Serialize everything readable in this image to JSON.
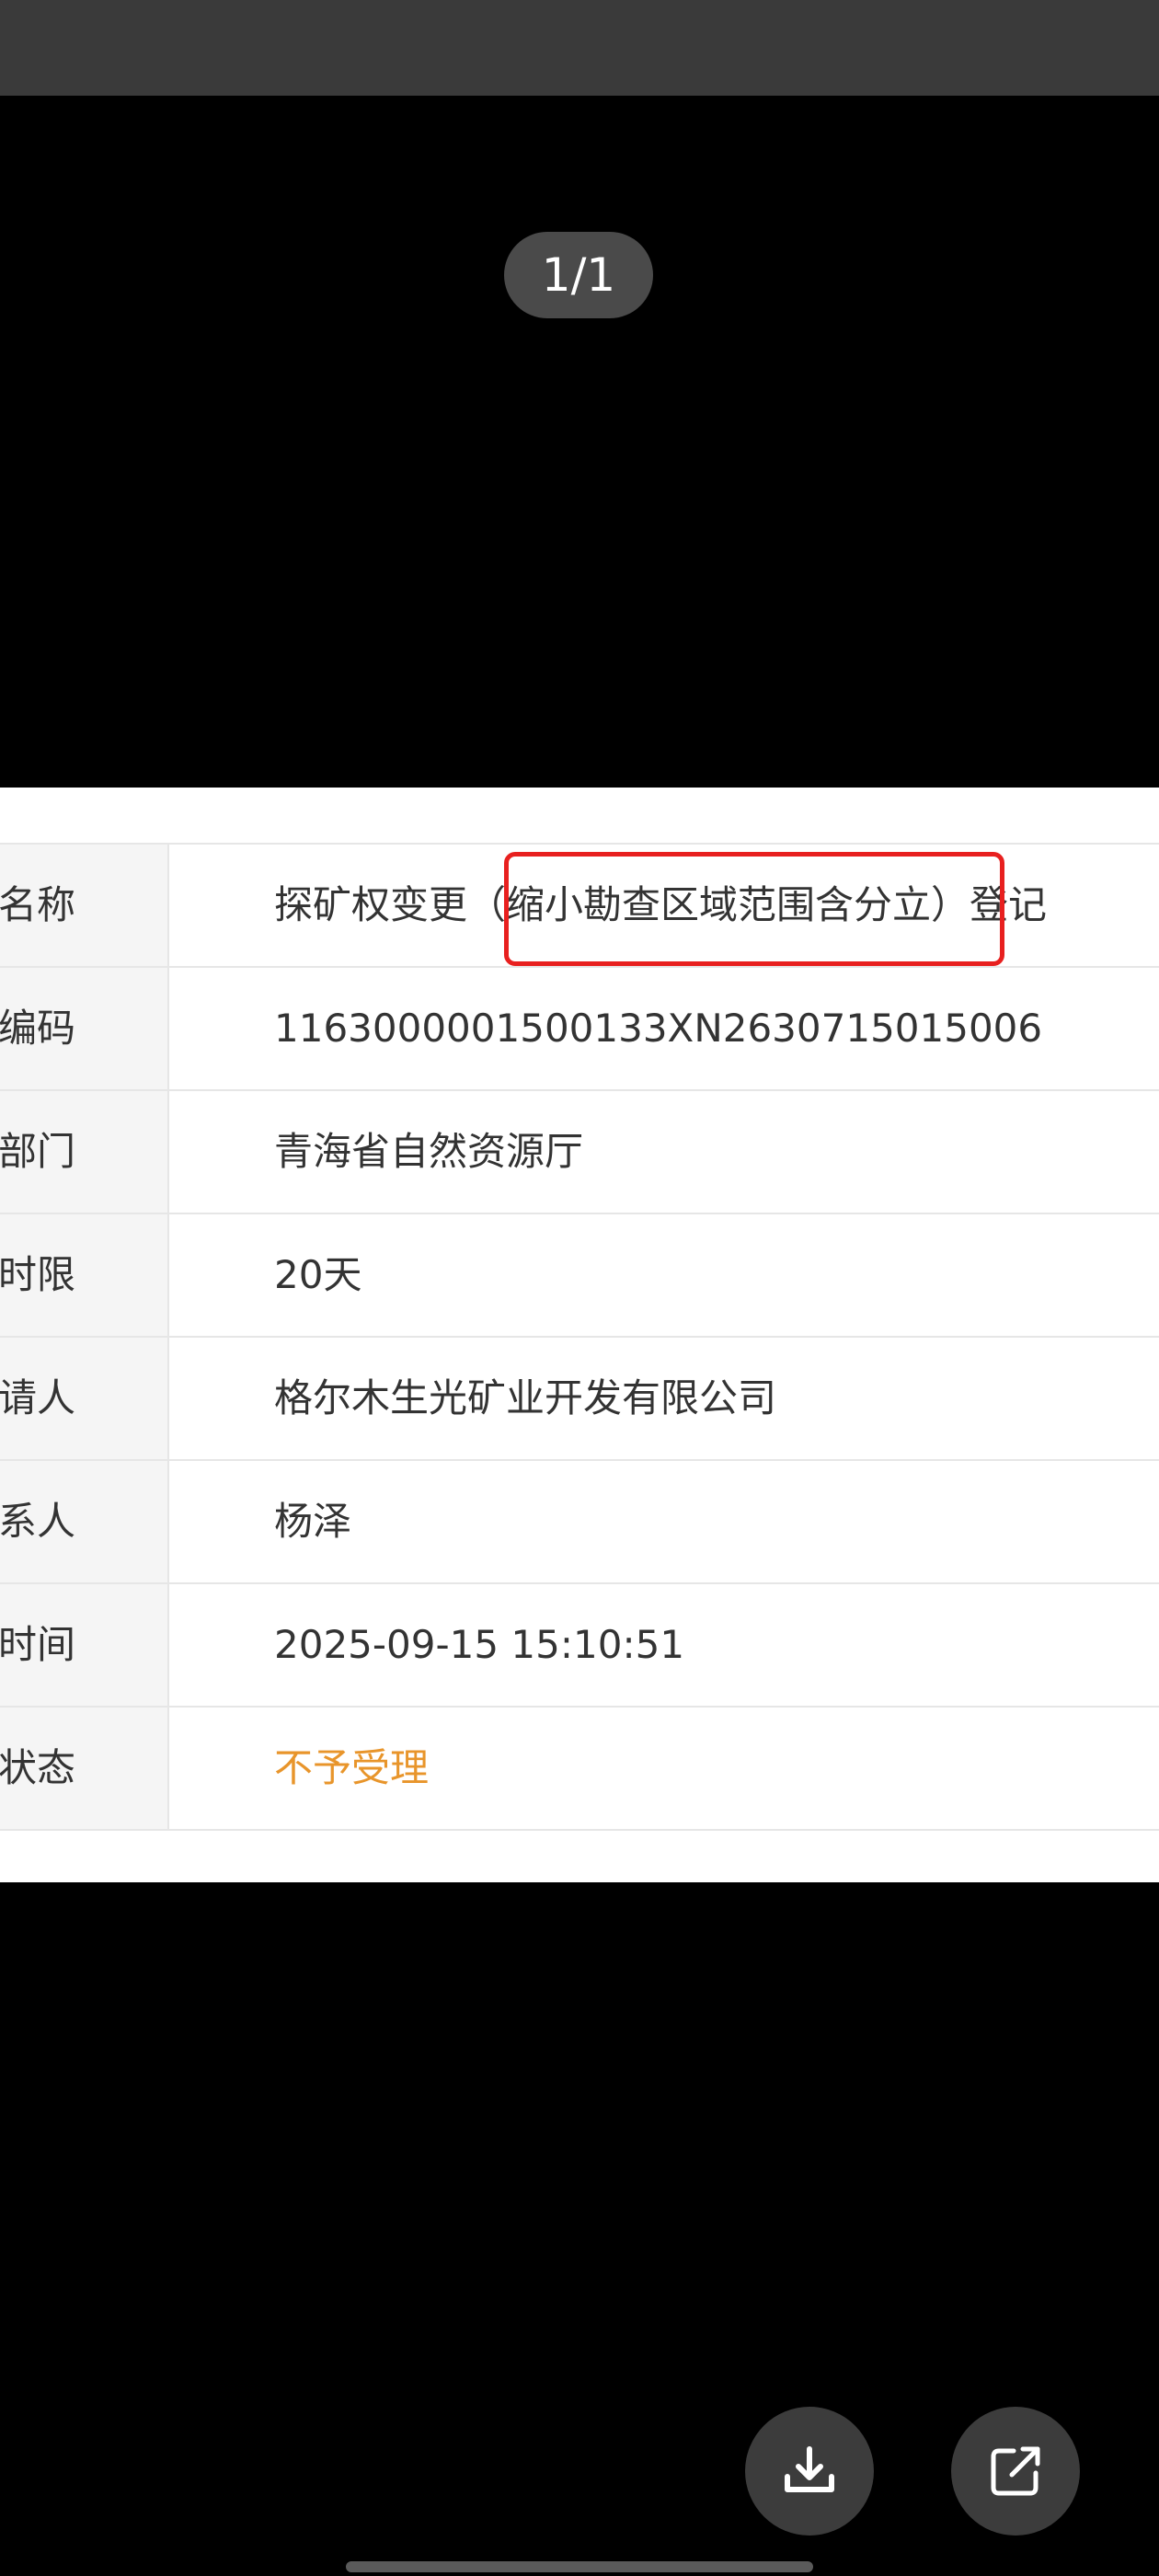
{
  "viewer": {
    "page_counter": "1/1"
  },
  "table": {
    "rows": [
      {
        "label": "事项名称",
        "value": "探矿权变更（缩小勘查区域范围含分立）登记"
      },
      {
        "label": "申报编码",
        "value": "1163000001500133XN2630715015006"
      },
      {
        "label": "受理部门",
        "value": "青海省自然资源厅"
      },
      {
        "label": "承诺时限",
        "value": "20天"
      },
      {
        "label": "项目申请人",
        "value": "格尔木生光矿业开发有限公司"
      },
      {
        "label": "联系人",
        "value": "杨泽"
      },
      {
        "label": "申报时间",
        "value": "2025-09-15 15:10:51"
      },
      {
        "label": "办理状态",
        "value": "不予受理"
      }
    ]
  },
  "colors": {
    "status": "#e8952b",
    "highlight": "#e8201f"
  },
  "actions": {
    "download_icon": "download-icon",
    "share_icon": "share-external-icon"
  }
}
